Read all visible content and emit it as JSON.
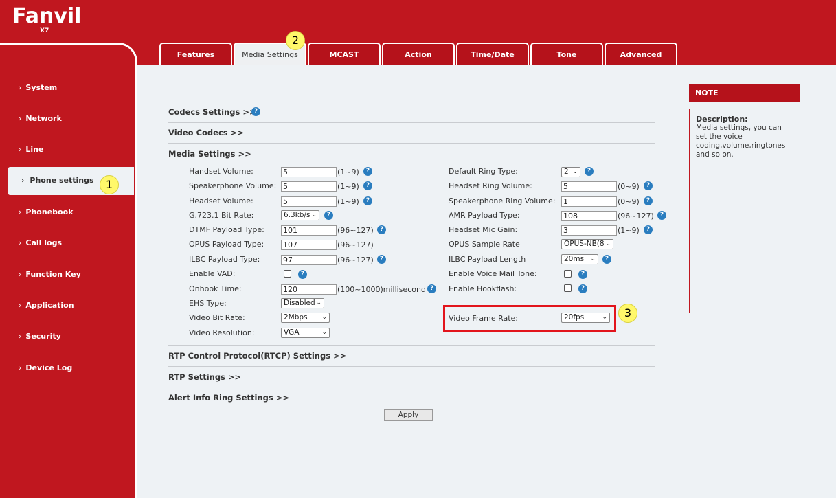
{
  "brand": {
    "name": "Fanvil",
    "model": "X7"
  },
  "tabs": [
    "Features",
    "Media Settings",
    "MCAST",
    "Action",
    "Time/Date",
    "Tone",
    "Advanced"
  ],
  "sidebar": {
    "items": [
      "System",
      "Network",
      "Line",
      "Phone settings",
      "Phonebook",
      "Call logs",
      "Function Key",
      "Application",
      "Security",
      "Device Log"
    ],
    "active": "Phone settings"
  },
  "sections": {
    "codecs": "Codecs Settings >>",
    "video_codecs": "Video Codecs >>",
    "media": "Media Settings >>",
    "rtcp": "RTP Control Protocol(RTCP) Settings >>",
    "rtp": "RTP Settings >>",
    "alert": "Alert Info Ring Settings >>"
  },
  "left_fields": {
    "handset_volume": {
      "label": "Handset Volume:",
      "value": "5",
      "range": "(1~9)"
    },
    "speakerphone_volume": {
      "label": "Speakerphone Volume:",
      "value": "5",
      "range": "(1~9)"
    },
    "headset_volume": {
      "label": "Headset Volume:",
      "value": "5",
      "range": "(1~9)"
    },
    "g7231_bit_rate": {
      "label": "G.723.1 Bit Rate:",
      "value": "6.3kb/s"
    },
    "dtmf_payload": {
      "label": "DTMF Payload Type:",
      "value": "101",
      "range": "(96~127)"
    },
    "opus_payload": {
      "label": "OPUS Payload Type:",
      "value": "107",
      "range": "(96~127)"
    },
    "ilbc_payload": {
      "label": "ILBC Payload Type:",
      "value": "97",
      "range": "(96~127)"
    },
    "enable_vad": {
      "label": "Enable VAD:"
    },
    "onhook_time": {
      "label": "Onhook Time:",
      "value": "120",
      "range": "(100~1000)millisecond"
    },
    "ehs_type": {
      "label": "EHS Type:",
      "value": "Disabled"
    },
    "video_bit_rate": {
      "label": "Video Bit Rate:",
      "value": "2Mbps"
    },
    "video_resolution": {
      "label": "Video Resolution:",
      "value": "VGA"
    }
  },
  "right_fields": {
    "default_ring_type": {
      "label": "Default Ring Type:",
      "value": "2"
    },
    "headset_ring_volume": {
      "label": "Headset Ring Volume:",
      "value": "5",
      "range": "(0~9)"
    },
    "speakerphone_ring_volume": {
      "label": "Speakerphone Ring Volume:",
      "value": "1",
      "range": "(0~9)"
    },
    "amr_payload": {
      "label": "AMR Payload Type:",
      "value": "108",
      "range": "(96~127)"
    },
    "headset_mic_gain": {
      "label": "Headset Mic Gain:",
      "value": "3",
      "range": "(1~9)"
    },
    "opus_sample_rate": {
      "label": "OPUS Sample Rate",
      "value": "OPUS-NB(8"
    },
    "ilbc_payload_length": {
      "label": "ILBC Payload Length",
      "value": "20ms"
    },
    "enable_voice_mail_tone": {
      "label": "Enable Voice Mail Tone:"
    },
    "enable_hookflash": {
      "label": "Enable Hookflash:"
    },
    "video_frame_rate": {
      "label": "Video Frame Rate:",
      "value": "20fps"
    }
  },
  "apply_label": "Apply",
  "note": {
    "header": "NOTE",
    "title": "Description:",
    "text": "Media settings, you can set the voice coding,volume,ringtones and so on."
  },
  "callouts": [
    "1",
    "2",
    "3"
  ],
  "icons": {
    "help": "help-icon",
    "dropdown": "chevron-down-icon",
    "chevron": "chevron-right-icon"
  },
  "colors": {
    "brand_red": "#c0171f",
    "panel": "#eef2f5",
    "help_blue": "#2a7dbf",
    "highlight": "#e2141c",
    "callout": "#fff86a"
  }
}
